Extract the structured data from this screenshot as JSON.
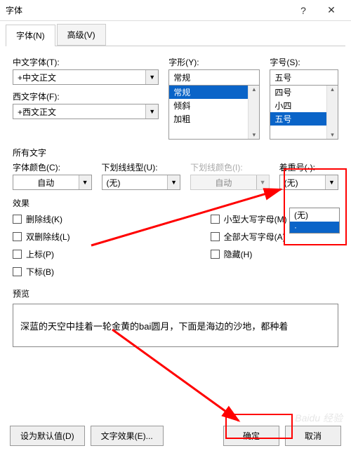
{
  "titlebar": {
    "title": "字体",
    "help": "?",
    "close": "✕"
  },
  "tabs": {
    "font": "字体(N)",
    "advanced": "高级(V)"
  },
  "labels": {
    "chinese_font": "中文字体(T):",
    "western_font": "西文字体(F):",
    "style": "字形(Y):",
    "size": "字号(S):",
    "all_text": "所有文字",
    "font_color": "字体颜色(C):",
    "underline_style": "下划线线型(U):",
    "underline_color": "下划线颜色(I):",
    "emphasis": "着重号(·):",
    "effects": "效果",
    "preview": "预览"
  },
  "fonts": {
    "chinese": "+中文正文",
    "western": "+西文正文"
  },
  "style": {
    "value": "常规",
    "options": [
      "常规",
      "倾斜",
      "加粗"
    ]
  },
  "size": {
    "value": "五号",
    "options": [
      "四号",
      "小四",
      "五号"
    ]
  },
  "color": {
    "value": "自动"
  },
  "underline": {
    "value": "(无)"
  },
  "underline_color": {
    "value": "自动"
  },
  "emphasis": {
    "value": "(无)",
    "options": [
      "(无)",
      "·"
    ]
  },
  "effects": {
    "strike": "删除线(K)",
    "double_strike": "双删除线(L)",
    "superscript": "上标(P)",
    "subscript": "下标(B)",
    "small_caps": "小型大写字母(M)",
    "all_caps": "全部大写字母(A)",
    "hidden": "隐藏(H)"
  },
  "preview_text": "深蓝的天空中挂着一轮金黄的bai圆月，下面是海边的沙地，都种着",
  "buttons": {
    "default": "设为默认值(D)",
    "text_effects": "文字效果(E)...",
    "ok": "确定",
    "cancel": "取消"
  },
  "watermark": "Baidu 经验"
}
